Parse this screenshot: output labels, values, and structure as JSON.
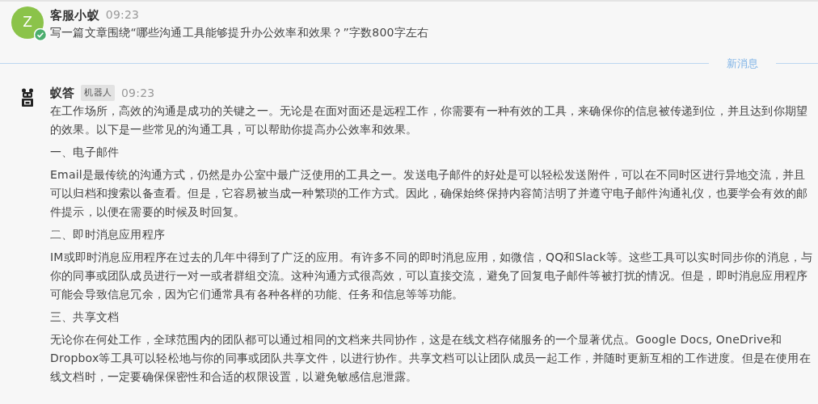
{
  "messages": [
    {
      "kind": "user",
      "avatar_letter": "Z",
      "verified": true,
      "sender": "客服小蚁",
      "time": "09:23",
      "paragraphs": [
        "写一篇文章围绕“哪些沟通工具能够提升办公效率和效果？”字数800字左右"
      ]
    },
    {
      "kind": "bot",
      "sender": "蚁答",
      "badge": "机器人",
      "time": "09:23",
      "paragraphs": [
        "在工作场所，高效的沟通是成功的关键之一。无论是在面对面还是远程工作，你需要有一种有效的工具，来确保你的信息被传递到位，并且达到你期望的效果。以下是一些常见的沟通工具，可以帮助你提高办公效率和效果。",
        "一、电子邮件",
        "Email是最传统的沟通方式，仍然是办公室中最广泛使用的工具之一。发送电子邮件的好处是可以轻松发送附件，可以在不同时区进行异地交流，并且可以归档和搜索以备查看。但是，它容易被当成一种繁琐的工作方式。因此，确保始终保持内容简洁明了并遵守电子邮件沟通礼仪，也要学会有效的邮件提示，以便在需要的时候及时回复。",
        "二、即时消息应用程序",
        "IM或即时消息应用程序在过去的几年中得到了广泛的应用。有许多不同的即时消息应用，如微信，QQ和Slack等。这些工具可以实时同步你的消息，与你的同事或团队成员进行一对一或者群组交流。这种沟通方式很高效，可以直接交流，避免了回复电子邮件等被打扰的情况。但是，即时消息应用程序可能会导致信息冗余，因为它们通常具有各种各样的功能、任务和信息等等功能。",
        "三、共享文档",
        "无论你在何处工作，全球范围内的团队都可以通过相同的文档来共同协作，这是在线文档存储服务的一个显著优点。Google Docs, OneDrive和Dropbox等工具可以轻松地与你的同事或团队共享文件，以进行协作。共享文档可以让团队成员一起工作，并随时更新互相的工作进度。但是在使用在线文档时，一定要确保保密性和合适的权限设置，以避免敏感信息泄露。"
      ]
    }
  ],
  "divider": {
    "label": "新消息"
  }
}
